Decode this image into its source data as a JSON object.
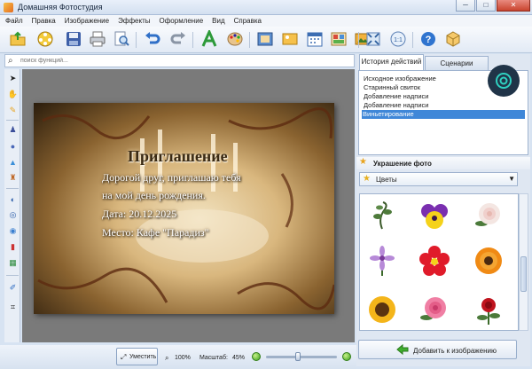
{
  "window": {
    "title": "Домашняя Фотостудия",
    "minimize": "─",
    "maximize": "□",
    "close": "✕"
  },
  "menu": [
    "Файл",
    "Правка",
    "Изображение",
    "Эффекты",
    "Оформление",
    "Вид",
    "Справка"
  ],
  "search": {
    "placeholder": "поиск функций..."
  },
  "photo_text": {
    "heading": "Приглашение",
    "line1": "Дорогой друг, приглашаю тебя",
    "line2": "на мой день рождения.",
    "line3": "Дата: 20.12.2025",
    "line4": "Место: Кафе \"Парадиз\""
  },
  "history": {
    "tabs": [
      "История действий",
      "Сценарии"
    ],
    "items": [
      "Исходное изображение",
      "Старинный свиток",
      "Добавление надписи",
      "Добавление надписи",
      "Виньетирование"
    ],
    "selected_index": 4
  },
  "decor": {
    "header": "Украшение фото",
    "category": "Цветы",
    "gallery_items": [
      "vine-sprig",
      "yellow-purple-pansy",
      "white-rose",
      "purple-daisy",
      "red-flower",
      "orange-gerbera",
      "sunflower",
      "pink-rose",
      "red-rose-sprig"
    ]
  },
  "actions": {
    "add_to_image": "Добавить к изображению"
  },
  "status": {
    "fit_label": "Уместить",
    "zoom_100": "100%",
    "scale_label": "Масштаб:",
    "scale_value": "45%",
    "zoom_fraction": 0.45
  },
  "colors": {
    "selection": "#3f87d8",
    "canvas_bg": "#7a7a7a"
  }
}
